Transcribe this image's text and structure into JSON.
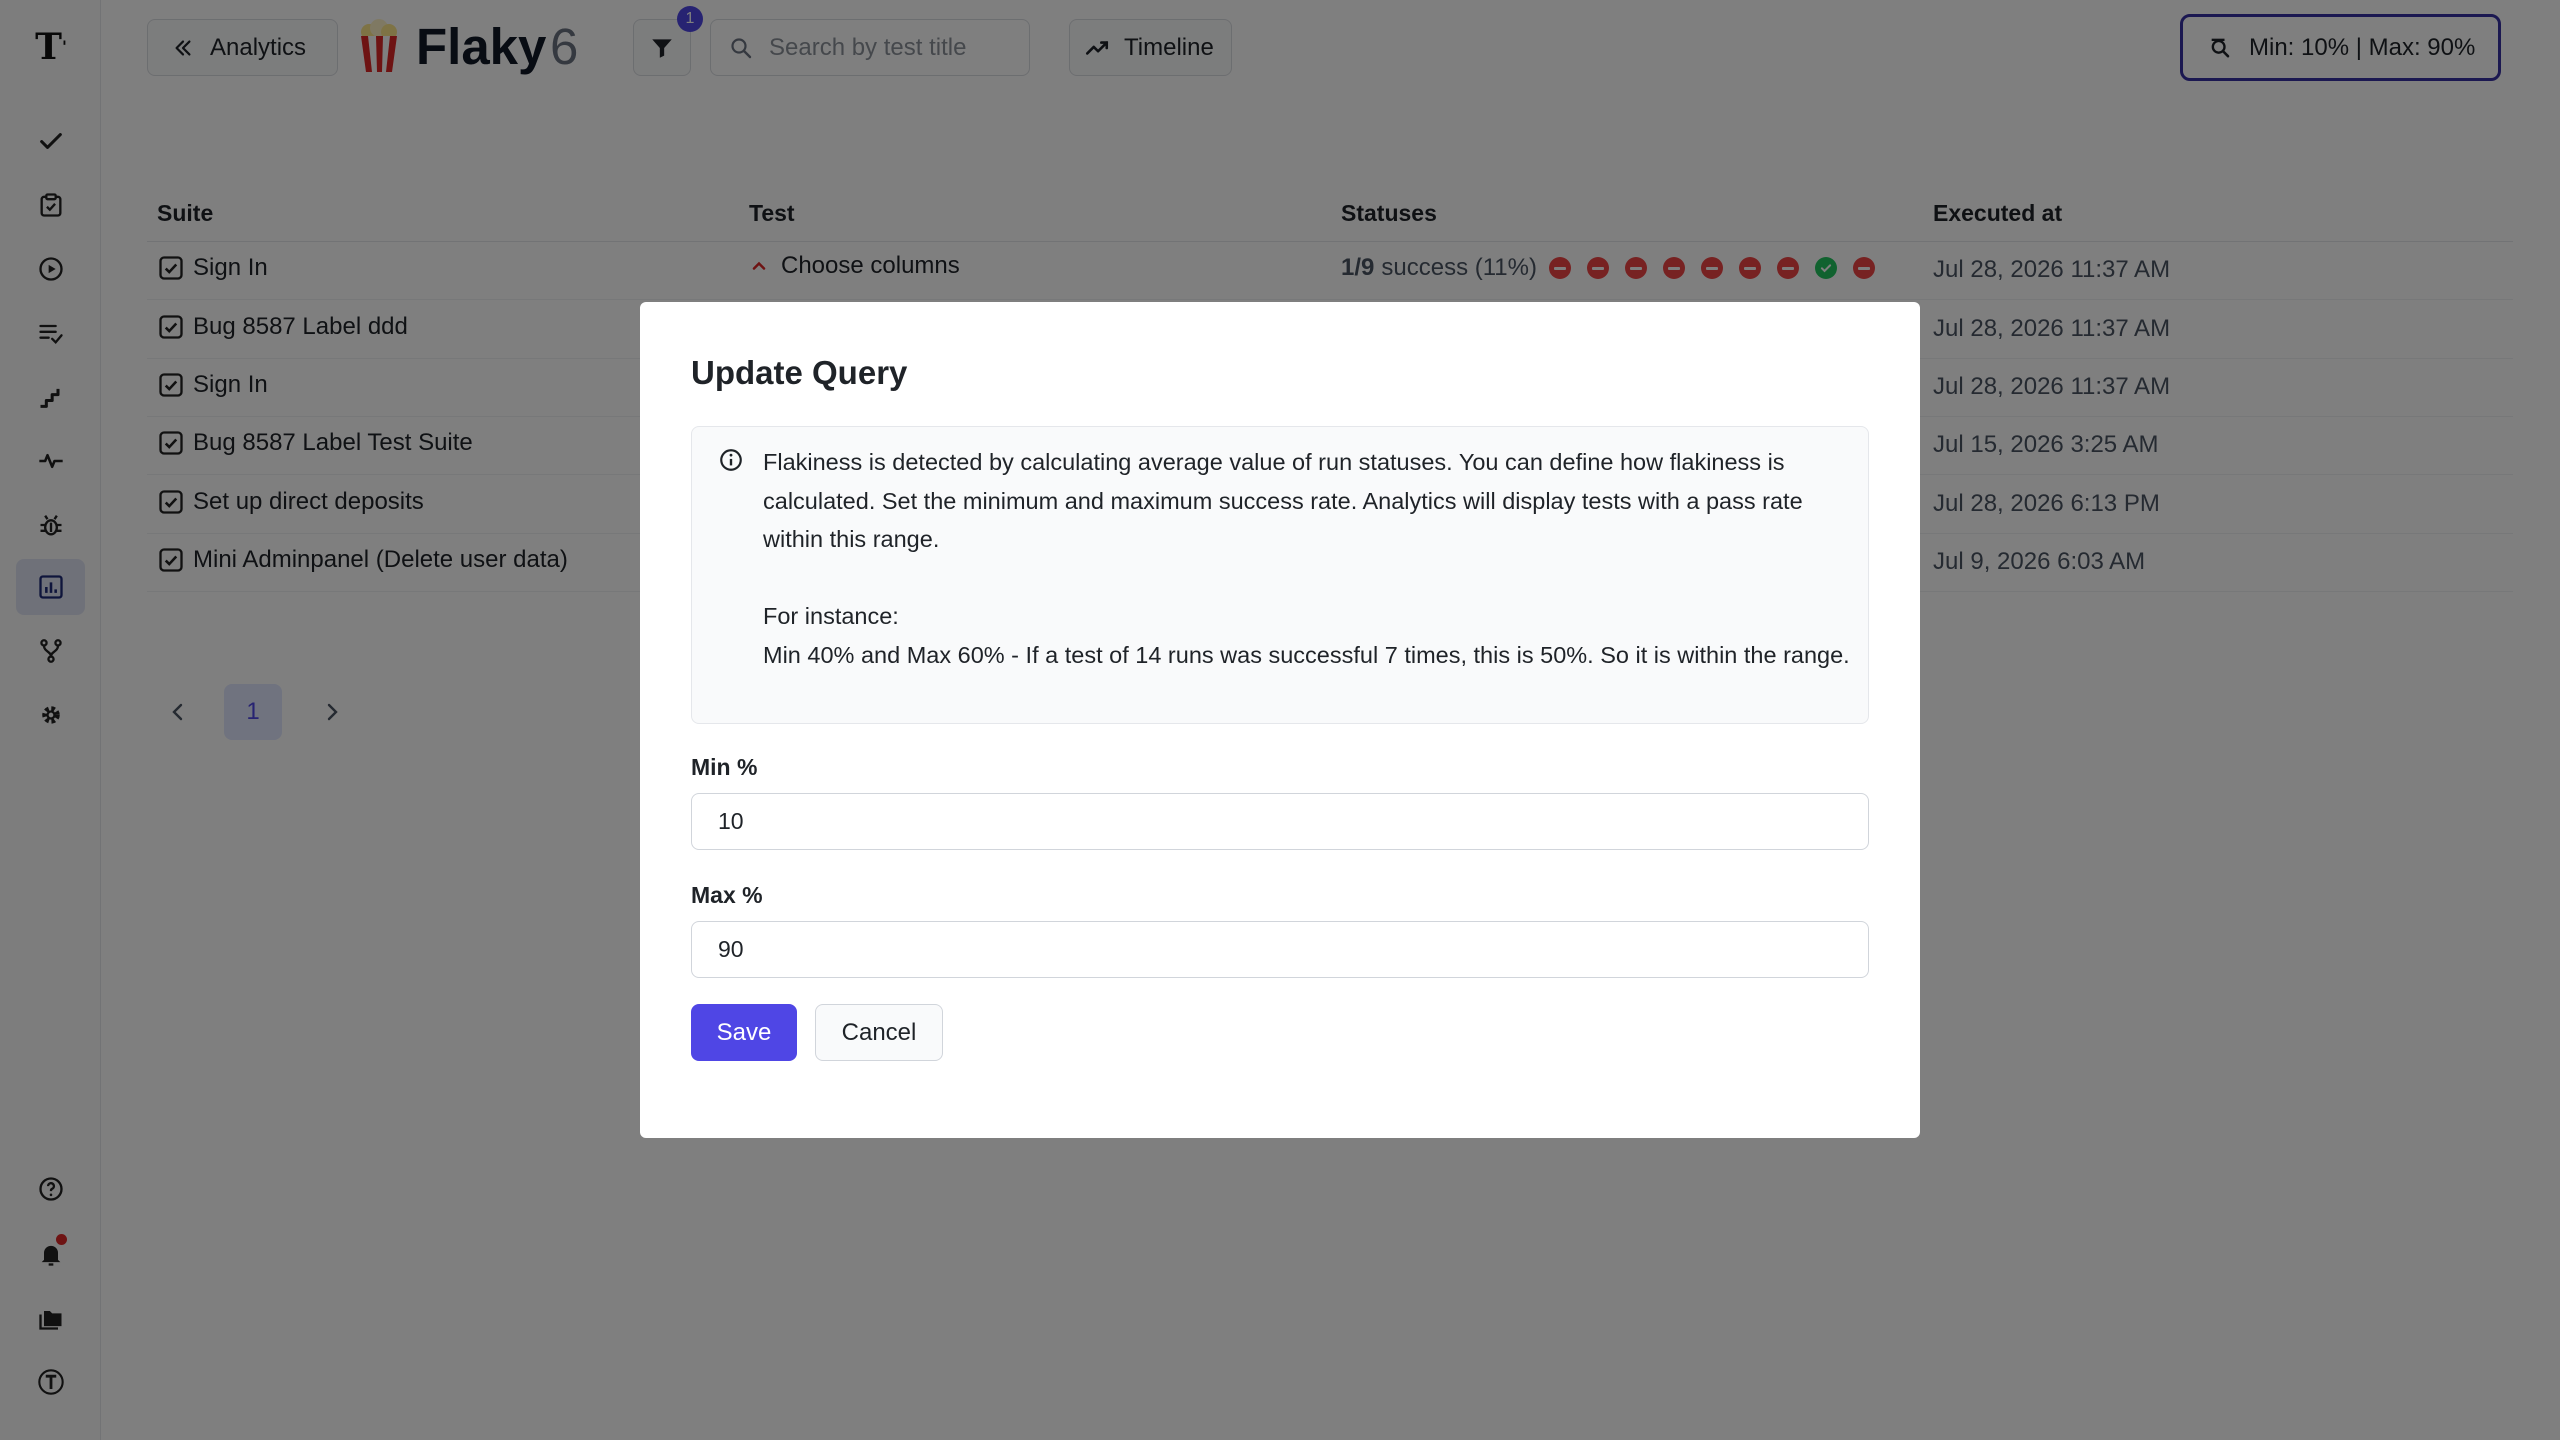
{
  "header": {
    "back_label": "Analytics",
    "title": "Flaky",
    "count": "6",
    "filter_badge": "1",
    "search_placeholder": "Search by test title",
    "timeline_label": "Timeline",
    "range_label": "Min: 10% | Max: 90%"
  },
  "table": {
    "columns": [
      "Suite",
      "Test",
      "Statuses",
      "Executed at"
    ],
    "choose_columns_label": "Choose columns",
    "first_status": {
      "count": "1/9",
      "text": "success (11%)",
      "dots": [
        "failed",
        "failed",
        "failed",
        "failed",
        "failed",
        "failed",
        "failed",
        "passed",
        "failed"
      ]
    },
    "rows": [
      {
        "suite": "Sign In",
        "date": "Jul 28, 2026 11:37 AM"
      },
      {
        "suite": "Bug 8587 Label ddd",
        "date": "Jul 28, 2026 11:37 AM"
      },
      {
        "suite": "Sign In",
        "date": "Jul 28, 2026 11:37 AM"
      },
      {
        "suite": "Bug 8587 Label Test Suite",
        "date": "Jul 15, 2026 3:25 AM"
      },
      {
        "suite": "Set up direct deposits",
        "date": "Jul 28, 2026 6:13 PM"
      },
      {
        "suite": "Mini Adminpanel (Delete user data)",
        "date": "Jul 9, 2026 6:03 AM"
      }
    ]
  },
  "pagination": {
    "current_page": "1"
  },
  "modal": {
    "title": "Update Query",
    "info_line1": "Flakiness is detected by calculating average value of run statuses. You can define how flakiness is calculated. Set the minimum and maximum success rate. Analytics will display tests with a pass rate within this range.",
    "info_line2": "For instance:",
    "info_line3": "Min 40% and Max 60% - If a test of 14 runs was successful 7 times, this is 50%. So it is within the range.",
    "min_label": "Min %",
    "min_value": "10",
    "max_label": "Max %",
    "max_value": "90",
    "save_label": "Save",
    "cancel_label": "Cancel"
  },
  "colors": {
    "accent": "#4f46e5",
    "status_failed": "#ef4444",
    "status_passed": "#22c55e"
  }
}
